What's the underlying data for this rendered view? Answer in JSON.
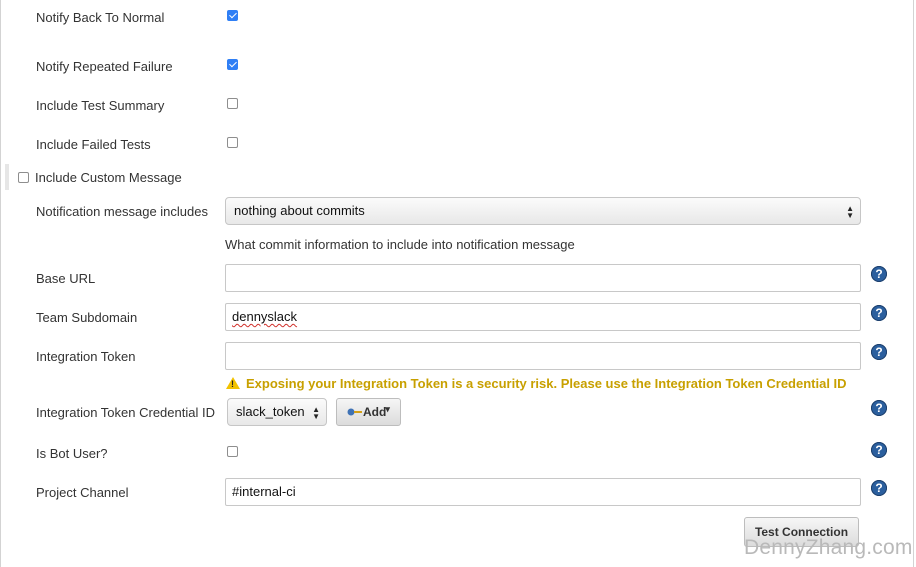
{
  "options": {
    "notify_back_to_normal": {
      "label": "Notify Back To Normal",
      "checked": true
    },
    "notify_repeated_failure": {
      "label": "Notify Repeated Failure",
      "checked": true
    },
    "include_test_summary": {
      "label": "Include Test Summary",
      "checked": false
    },
    "include_failed_tests": {
      "label": "Include Failed Tests",
      "checked": false
    },
    "include_custom_message": {
      "label": "Include Custom Message",
      "checked": false
    }
  },
  "notification": {
    "label": "Notification message includes",
    "selected": "nothing about commits",
    "description": "What commit information to include into notification message"
  },
  "fields": {
    "base_url": {
      "label": "Base URL",
      "value": ""
    },
    "team_subdomain": {
      "label": "Team Subdomain",
      "value": "dennyslack"
    },
    "integration_token": {
      "label": "Integration Token",
      "value": ""
    },
    "token_warning": "Exposing your Integration Token is a security risk. Please use the Integration Token Credential ID",
    "credential_id": {
      "label": "Integration Token Credential ID",
      "selected": "slack_token",
      "add_label": "Add"
    },
    "is_bot_user": {
      "label": "Is Bot User?",
      "checked": false
    },
    "project_channel": {
      "label": "Project Channel",
      "value": "#internal-ci"
    }
  },
  "buttons": {
    "test_connection": "Test Connection"
  },
  "help_icon": "?",
  "watermark": "DennyZhang.com"
}
